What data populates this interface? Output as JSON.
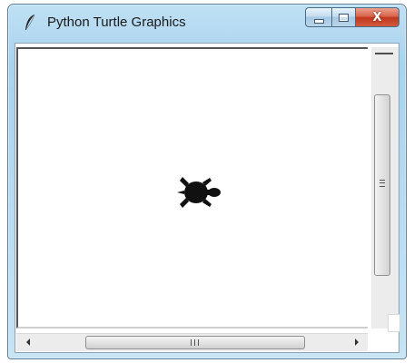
{
  "window": {
    "title": "Python Turtle Graphics",
    "app_icon": "feather-icon",
    "caption_buttons": {
      "minimize_icon": "minimize-icon",
      "maximize_icon": "maximize-icon",
      "close_icon": "close-icon",
      "close_glyph": "X"
    },
    "colors": {
      "frame": "#a8d2ee",
      "close_button": "#c1371c",
      "canvas_background": "#ffffff",
      "turtle": "#111111"
    }
  },
  "canvas": {
    "turtle_icon": "turtle-icon"
  },
  "scrollbars": {
    "vertical_grip_icon": "grip-lines-icon",
    "horizontal_grip_icon": "grip-lines-icon",
    "left_arrow_icon": "arrow-left-icon",
    "right_arrow_icon": "arrow-right-icon"
  }
}
